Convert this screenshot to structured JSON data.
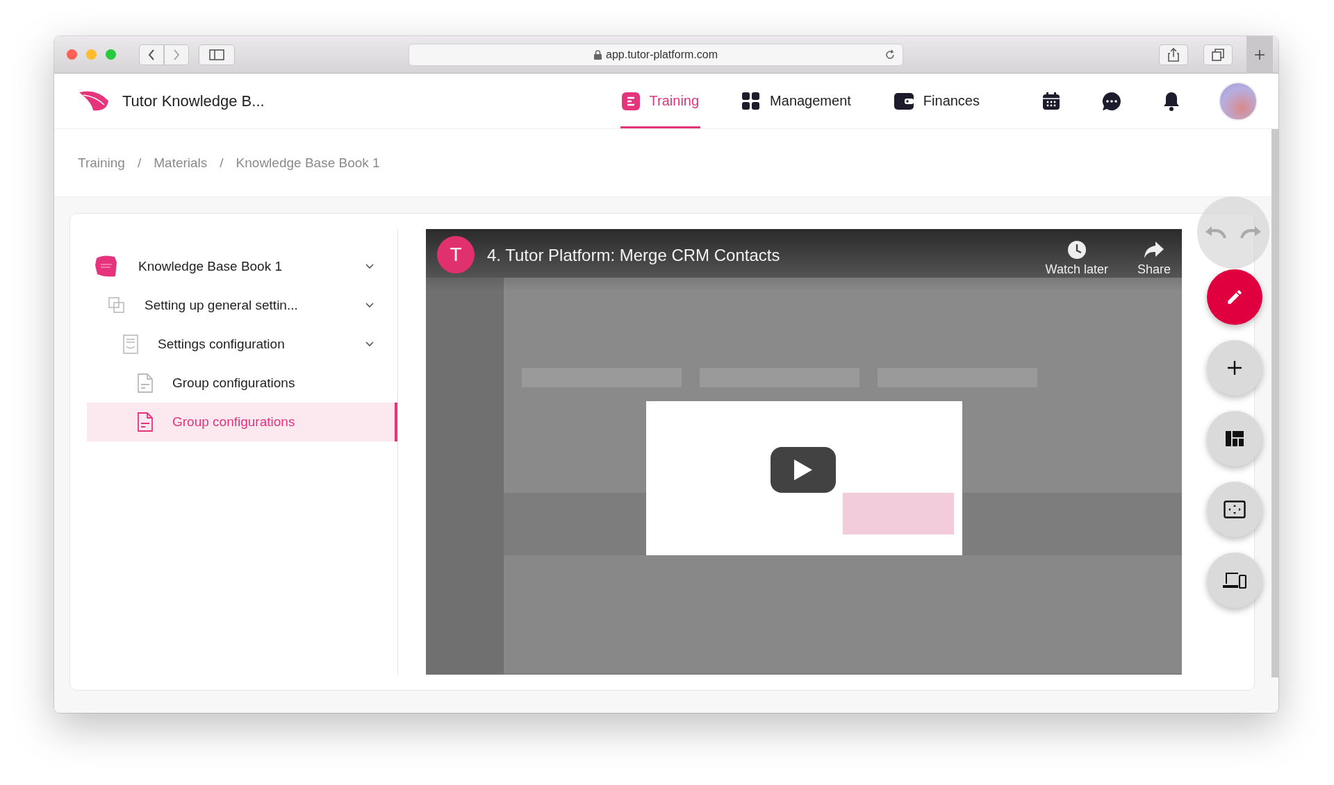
{
  "browser": {
    "url": "app.tutor-platform.com"
  },
  "app": {
    "title": "Tutor Knowledge B...",
    "nav": [
      {
        "label": "Training",
        "kind": "training",
        "selected": true
      },
      {
        "label": "Management",
        "kind": "management",
        "selected": false
      },
      {
        "label": "Finances",
        "kind": "finances",
        "selected": false
      }
    ]
  },
  "breadcrumbs": [
    {
      "label": "Training"
    },
    {
      "separator": "/",
      "label": "Materials"
    },
    {
      "separator": "/",
      "label": "Knowledge Base Book 1"
    }
  ],
  "tree": [
    {
      "label": "Knowledge Base Book 1",
      "kind": "book",
      "expanded": true,
      "selected": false,
      "children": [
        {
          "label": "Setting up general settin...",
          "kind": "section",
          "expanded": true,
          "selected": false,
          "children": [
            {
              "label": "Settings configuration",
              "kind": "list",
              "expanded": true,
              "selected": false,
              "children": [
                {
                  "label": "Group configurations",
                  "kind": "page",
                  "selected": false
                },
                {
                  "label": "Group configurations",
                  "kind": "page",
                  "selected": true
                }
              ]
            }
          ]
        }
      ]
    }
  ],
  "video": {
    "channel_initial": "T",
    "title": "4. Tutor Platform: Merge CRM Contacts",
    "actions": [
      {
        "kind": "clock",
        "label": "Watch later"
      },
      {
        "kind": "share",
        "label": "Share"
      }
    ]
  },
  "tools": [
    {
      "kind": "edit",
      "primary": true
    },
    {
      "kind": "add",
      "primary": false
    },
    {
      "kind": "layout",
      "primary": false
    },
    {
      "kind": "fullscreen",
      "primary": false
    },
    {
      "kind": "devices",
      "primary": false
    }
  ]
}
